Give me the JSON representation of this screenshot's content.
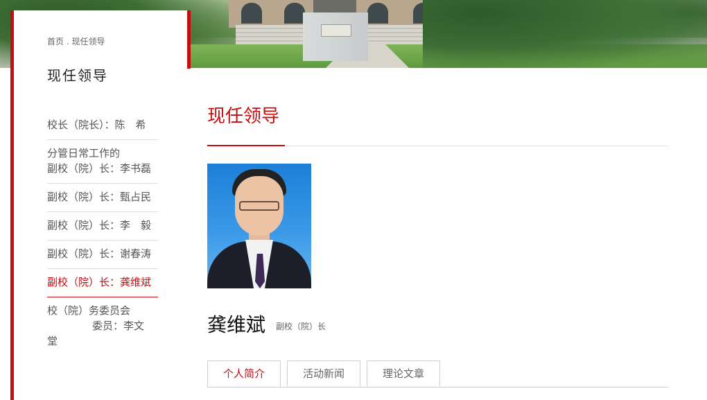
{
  "breadcrumb": "首页 . 现任领导",
  "sidebar": {
    "title": "现任领导",
    "items": [
      {
        "label": "校长（院长）：陈　希"
      },
      {
        "label_line1": "分管日常工作的",
        "label_line2": "副校（院）长：李书磊"
      },
      {
        "label": "副校（院）长：甄占民"
      },
      {
        "label": "副校（院）长：李　毅"
      },
      {
        "label": "副校（院）长：谢春涛"
      },
      {
        "label": "副校（院）长：龚维斌",
        "active": true
      },
      {
        "label_line1": "校（院）务委员会",
        "label_line2": "委员：李文",
        "label_line3": "堂"
      }
    ]
  },
  "main": {
    "title": "现任领导",
    "person": {
      "name": "龚维斌",
      "role": "副校（院）长"
    },
    "tabs": [
      {
        "label": "个人简介",
        "active": true
      },
      {
        "label": "活动新闻"
      },
      {
        "label": "理论文章"
      }
    ]
  },
  "colors": {
    "accent": "#c40d11",
    "divider": "#dcdcdc"
  }
}
